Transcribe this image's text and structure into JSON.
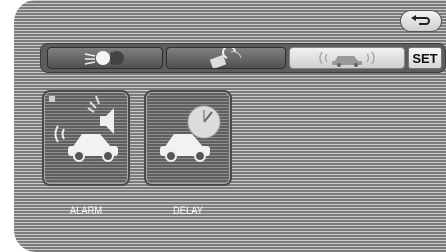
{
  "tabs": [
    {
      "icon": "lights-icon"
    },
    {
      "icon": "door-lock-icon"
    },
    {
      "icon": "car-sound-icon"
    }
  ],
  "set_label": "SET",
  "tiles": [
    {
      "label": "ALARM",
      "icon": "alarm-car-icon"
    },
    {
      "label": "DELAY",
      "icon": "delay-car-icon"
    }
  ]
}
